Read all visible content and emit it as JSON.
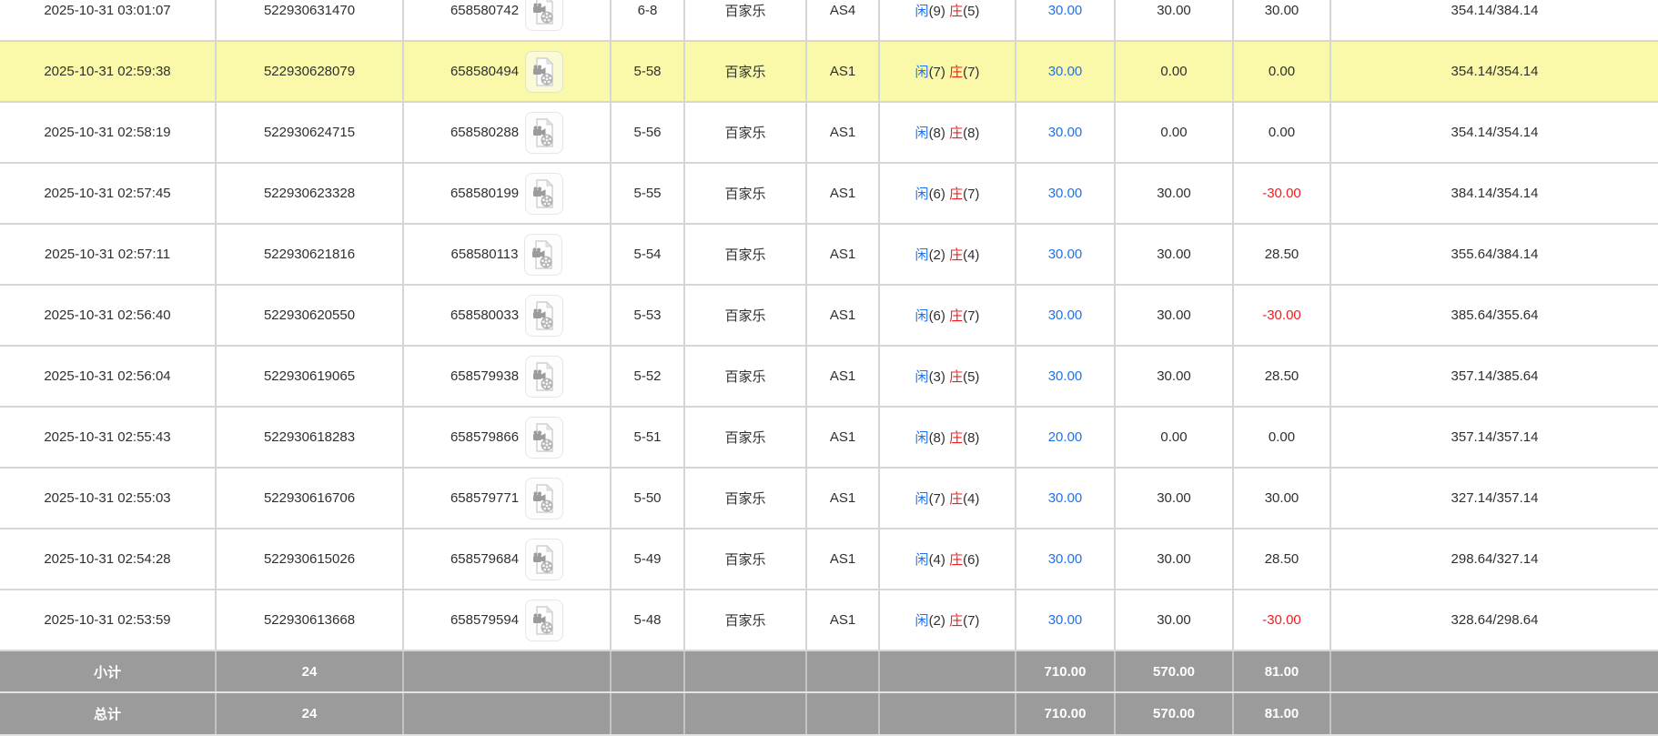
{
  "table": {
    "video_icon": "video-replay-icon",
    "rows": [
      {
        "time": "2025-10-31 03:01:07",
        "bet_id": "522930631470",
        "game_id": "658580742",
        "round": "6-8",
        "game_type": "百家乐",
        "table_name": "AS4",
        "result": {
          "player": "闲",
          "player_score": "(9)",
          "banker": "庄",
          "banker_score": "(5)"
        },
        "bet": "30.00",
        "valid": "30.00",
        "win_loss": "30.00",
        "balance": "354.14/384.14",
        "highlighted": false
      },
      {
        "time": "2025-10-31 02:59:38",
        "bet_id": "522930628079",
        "game_id": "658580494",
        "round": "5-58",
        "game_type": "百家乐",
        "table_name": "AS1",
        "result": {
          "player": "闲",
          "player_score": "(7)",
          "banker": "庄",
          "banker_score": "(7)"
        },
        "bet": "30.00",
        "valid": "0.00",
        "win_loss": "0.00",
        "balance": "354.14/354.14",
        "highlighted": true
      },
      {
        "time": "2025-10-31 02:58:19",
        "bet_id": "522930624715",
        "game_id": "658580288",
        "round": "5-56",
        "game_type": "百家乐",
        "table_name": "AS1",
        "result": {
          "player": "闲",
          "player_score": "(8)",
          "banker": "庄",
          "banker_score": "(8)"
        },
        "bet": "30.00",
        "valid": "0.00",
        "win_loss": "0.00",
        "balance": "354.14/354.14",
        "highlighted": false
      },
      {
        "time": "2025-10-31 02:57:45",
        "bet_id": "522930623328",
        "game_id": "658580199",
        "round": "5-55",
        "game_type": "百家乐",
        "table_name": "AS1",
        "result": {
          "player": "闲",
          "player_score": "(6)",
          "banker": "庄",
          "banker_score": "(7)"
        },
        "bet": "30.00",
        "valid": "30.00",
        "win_loss": "-30.00",
        "balance": "384.14/354.14",
        "highlighted": false
      },
      {
        "time": "2025-10-31 02:57:11",
        "bet_id": "522930621816",
        "game_id": "658580113",
        "round": "5-54",
        "game_type": "百家乐",
        "table_name": "AS1",
        "result": {
          "player": "闲",
          "player_score": "(2)",
          "banker": "庄",
          "banker_score": "(4)"
        },
        "bet": "30.00",
        "valid": "30.00",
        "win_loss": "28.50",
        "balance": "355.64/384.14",
        "highlighted": false
      },
      {
        "time": "2025-10-31 02:56:40",
        "bet_id": "522930620550",
        "game_id": "658580033",
        "round": "5-53",
        "game_type": "百家乐",
        "table_name": "AS1",
        "result": {
          "player": "闲",
          "player_score": "(6)",
          "banker": "庄",
          "banker_score": "(7)"
        },
        "bet": "30.00",
        "valid": "30.00",
        "win_loss": "-30.00",
        "balance": "385.64/355.64",
        "highlighted": false
      },
      {
        "time": "2025-10-31 02:56:04",
        "bet_id": "522930619065",
        "game_id": "658579938",
        "round": "5-52",
        "game_type": "百家乐",
        "table_name": "AS1",
        "result": {
          "player": "闲",
          "player_score": "(3)",
          "banker": "庄",
          "banker_score": "(5)"
        },
        "bet": "30.00",
        "valid": "30.00",
        "win_loss": "28.50",
        "balance": "357.14/385.64",
        "highlighted": false
      },
      {
        "time": "2025-10-31 02:55:43",
        "bet_id": "522930618283",
        "game_id": "658579866",
        "round": "5-51",
        "game_type": "百家乐",
        "table_name": "AS1",
        "result": {
          "player": "闲",
          "player_score": "(8)",
          "banker": "庄",
          "banker_score": "(8)"
        },
        "bet": "20.00",
        "valid": "0.00",
        "win_loss": "0.00",
        "balance": "357.14/357.14",
        "highlighted": false
      },
      {
        "time": "2025-10-31 02:55:03",
        "bet_id": "522930616706",
        "game_id": "658579771",
        "round": "5-50",
        "game_type": "百家乐",
        "table_name": "AS1",
        "result": {
          "player": "闲",
          "player_score": "(7)",
          "banker": "庄",
          "banker_score": "(4)"
        },
        "bet": "30.00",
        "valid": "30.00",
        "win_loss": "30.00",
        "balance": "327.14/357.14",
        "highlighted": false
      },
      {
        "time": "2025-10-31 02:54:28",
        "bet_id": "522930615026",
        "game_id": "658579684",
        "round": "5-49",
        "game_type": "百家乐",
        "table_name": "AS1",
        "result": {
          "player": "闲",
          "player_score": "(4)",
          "banker": "庄",
          "banker_score": "(6)"
        },
        "bet": "30.00",
        "valid": "30.00",
        "win_loss": "28.50",
        "balance": "298.64/327.14",
        "highlighted": false
      },
      {
        "time": "2025-10-31 02:53:59",
        "bet_id": "522930613668",
        "game_id": "658579594",
        "round": "5-48",
        "game_type": "百家乐",
        "table_name": "AS1",
        "result": {
          "player": "闲",
          "player_score": "(2)",
          "banker": "庄",
          "banker_score": "(7)"
        },
        "bet": "30.00",
        "valid": "30.00",
        "win_loss": "-30.00",
        "balance": "328.64/298.64",
        "highlighted": false
      }
    ],
    "footer": [
      {
        "label": "小计",
        "count": "24",
        "bet": "710.00",
        "valid": "570.00",
        "win_loss": "81.00"
      },
      {
        "label": "总计",
        "count": "24",
        "bet": "710.00",
        "valid": "570.00",
        "win_loss": "81.00"
      }
    ]
  },
  "colors": {
    "highlight_row_bg": "#f9f9a9",
    "link_blue": "#1f72ee",
    "negative_red": "#f01e1e",
    "footer_bg": "#9b9b9b",
    "grid_border": "#d6d6d6"
  }
}
